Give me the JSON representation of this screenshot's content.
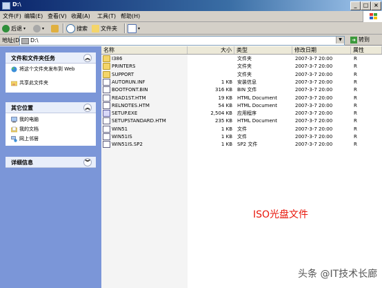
{
  "window": {
    "title": "D:\\"
  },
  "menu": [
    "文件(F)",
    "编辑(E)",
    "查看(V)",
    "收藏(A)",
    "工具(T)",
    "帮助(H)"
  ],
  "toolbar": {
    "back_label": "后退",
    "search_label": "搜索",
    "folders_label": "文件夹"
  },
  "address": {
    "label": "地址(D)",
    "value": "D:\\",
    "go_label": "转到"
  },
  "left_panels": {
    "tasks": {
      "title": "文件和文件夹任务",
      "items": [
        "将这个文件夹发布到 Web",
        "共享此文件夹"
      ]
    },
    "places": {
      "title": "其它位置",
      "items": [
        "我的电脑",
        "我的文档",
        "网上邻居"
      ]
    },
    "details": {
      "title": "详细信息"
    }
  },
  "columns": {
    "name": "名称",
    "size": "大小",
    "type": "类型",
    "modified": "修改日期",
    "attr": "属性"
  },
  "files": [
    {
      "name": "I386",
      "size": "",
      "type": "文件夹",
      "modified": "2007-3-7 20:00",
      "attr": "R",
      "icon": "folder"
    },
    {
      "name": "PRINTERS",
      "size": "",
      "type": "文件夹",
      "modified": "2007-3-7 20:00",
      "attr": "R",
      "icon": "folder"
    },
    {
      "name": "SUPPORT",
      "size": "",
      "type": "文件夹",
      "modified": "2007-3-7 20:00",
      "attr": "R",
      "icon": "folder"
    },
    {
      "name": "AUTORUN.INF",
      "size": "1 KB",
      "type": "安装信息",
      "modified": "2007-3-7 20:00",
      "attr": "R",
      "icon": "doc"
    },
    {
      "name": "BOOTFONT.BIN",
      "size": "316 KB",
      "type": "BIN 文件",
      "modified": "2007-3-7 20:00",
      "attr": "R",
      "icon": "doc"
    },
    {
      "name": "READ1ST.HTM",
      "size": "19 KB",
      "type": "HTML Document",
      "modified": "2007-3-7 20:00",
      "attr": "R",
      "icon": "doc"
    },
    {
      "name": "RELNOTES.HTM",
      "size": "54 KB",
      "type": "HTML Document",
      "modified": "2007-3-7 20:00",
      "attr": "R",
      "icon": "doc"
    },
    {
      "name": "SETUP.EXE",
      "size": "2,504 KB",
      "type": "应用程序",
      "modified": "2007-3-7 20:00",
      "attr": "R",
      "icon": "exe"
    },
    {
      "name": "SETUPSTANDARD.HTM",
      "size": "235 KB",
      "type": "HTML Document",
      "modified": "2007-3-7 20:00",
      "attr": "R",
      "icon": "doc"
    },
    {
      "name": "WIN51",
      "size": "1 KB",
      "type": "文件",
      "modified": "2007-3-7 20:00",
      "attr": "R",
      "icon": "doc"
    },
    {
      "name": "WIN51IS",
      "size": "1 KB",
      "type": "文件",
      "modified": "2007-3-7 20:00",
      "attr": "R",
      "icon": "doc"
    },
    {
      "name": "WIN51IS.SP2",
      "size": "1 KB",
      "type": "SP2 文件",
      "modified": "2007-3-7 20:00",
      "attr": "R",
      "icon": "doc"
    }
  ],
  "annotation": "ISO光盘文件",
  "watermark": "头条 @IT技术长廊"
}
